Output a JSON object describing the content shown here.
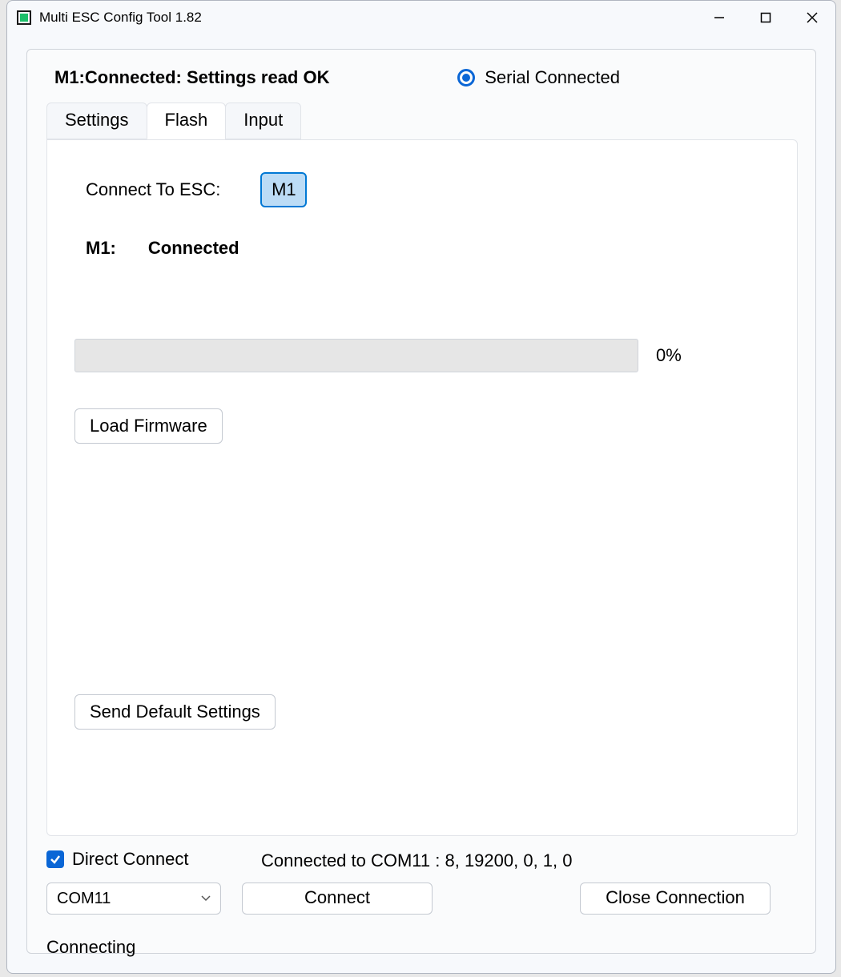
{
  "window": {
    "title": "Multi ESC Config Tool 1.82"
  },
  "header": {
    "status_title": "M1:Connected: Settings read OK",
    "serial_radio_label": "Serial Connected",
    "serial_radio_selected": true
  },
  "tabs": {
    "items": [
      {
        "label": "Settings",
        "active": false
      },
      {
        "label": "Flash",
        "active": true
      },
      {
        "label": "Input",
        "active": false
      }
    ]
  },
  "flash_tab": {
    "connect_label": "Connect To ESC:",
    "m1_button": "M1",
    "status_motor": "M1:",
    "status_value": "Connected",
    "progress_percent": "0%",
    "progress_value": 0,
    "load_firmware_label": "Load Firmware",
    "send_defaults_label": "Send Default Settings"
  },
  "bottom": {
    "direct_connect_label": "Direct Connect",
    "direct_connect_checked": true,
    "connection_info": "Connected to COM11 : 8, 19200, 0, 1, 0",
    "port_selected": "COM11",
    "connect_label": "Connect",
    "close_label": "Close Connection"
  },
  "footer": {
    "status": "Connecting"
  }
}
